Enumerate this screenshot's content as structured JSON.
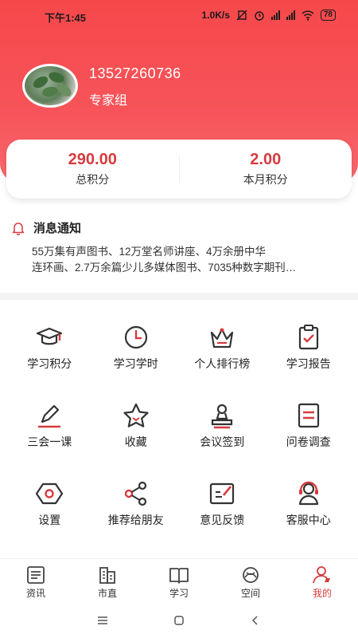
{
  "status_bar": {
    "time": "下午1:45",
    "network_speed": "1.0K/s",
    "battery": "78"
  },
  "profile": {
    "phone": "13527260736",
    "group": "专家组"
  },
  "points": {
    "total_value": "290.00",
    "total_label": "总积分",
    "month_value": "2.00",
    "month_label": "本月积分"
  },
  "notice": {
    "title": "消息通知",
    "line1": "55万集有声图书、12万堂名师讲座、4万余册中华",
    "line2": "连环画、2.7万余篇少儿多媒体图书、7035种数字期刊…"
  },
  "grid": [
    {
      "label": "学习积分",
      "icon": "graduation-cap-icon"
    },
    {
      "label": "学习学时",
      "icon": "clock-icon"
    },
    {
      "label": "个人排行榜",
      "icon": "crown-icon"
    },
    {
      "label": "学习报告",
      "icon": "clipboard-check-icon"
    },
    {
      "label": "三会一课",
      "icon": "pen-icon"
    },
    {
      "label": "收藏",
      "icon": "star-icon"
    },
    {
      "label": "会议签到",
      "icon": "stamp-icon"
    },
    {
      "label": "问卷调查",
      "icon": "list-doc-icon"
    },
    {
      "label": "设置",
      "icon": "hexagon-settings-icon"
    },
    {
      "label": "推荐给朋友",
      "icon": "share-icon"
    },
    {
      "label": "意见反馈",
      "icon": "feedback-icon"
    },
    {
      "label": "客服中心",
      "icon": "headset-icon"
    }
  ],
  "tabs": [
    {
      "label": "资讯",
      "icon": "news-icon",
      "active": false
    },
    {
      "label": "市直",
      "icon": "buildings-icon",
      "active": false
    },
    {
      "label": "学习",
      "icon": "book-icon",
      "active": false
    },
    {
      "label": "空间",
      "icon": "space-icon",
      "active": false
    },
    {
      "label": "我的",
      "icon": "profile-icon",
      "active": true
    }
  ],
  "colors": {
    "accent": "#d63b3e",
    "header": "#f6484b"
  }
}
